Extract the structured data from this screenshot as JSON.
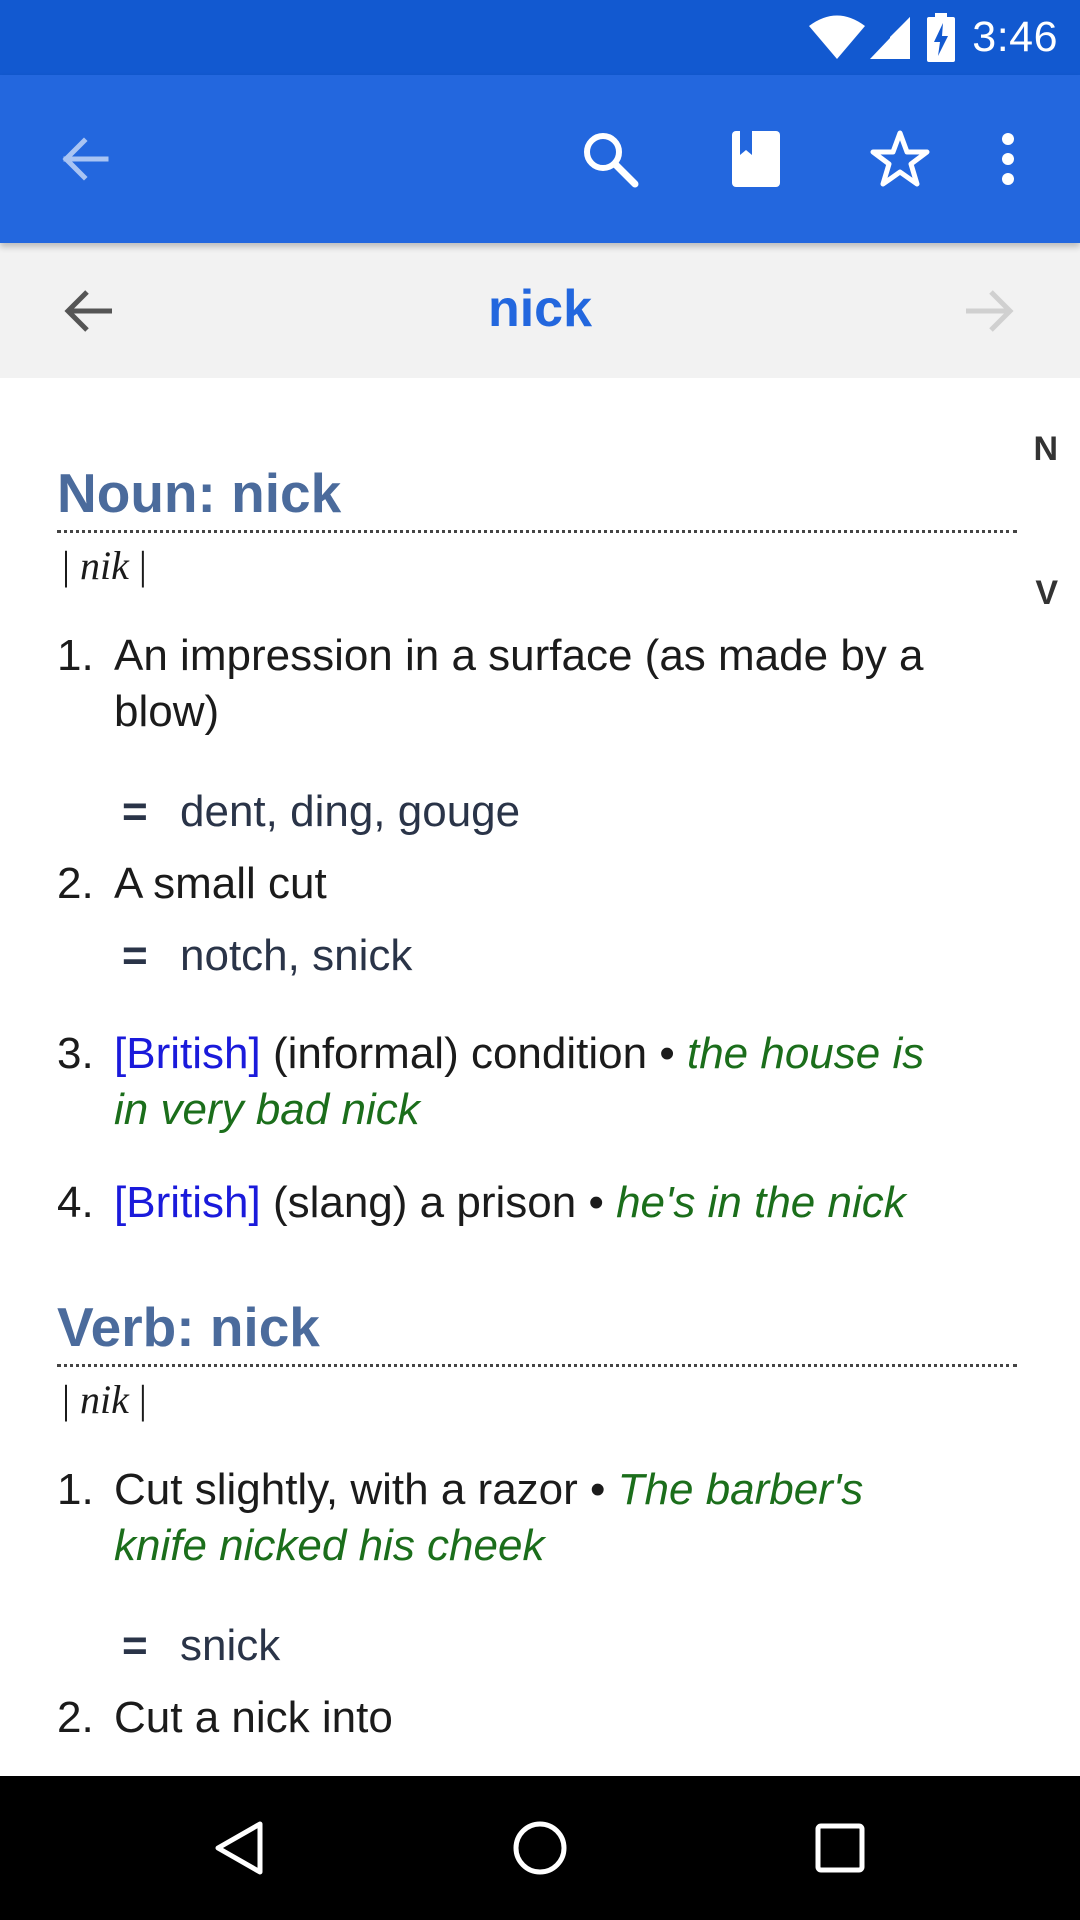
{
  "status_bar": {
    "time": "3:46",
    "icons": [
      "wifi-icon",
      "signal-icon",
      "battery-charging-icon"
    ]
  },
  "app_bar": {
    "icons": [
      "back-arrow-icon",
      "search-icon",
      "bookmark-icon",
      "star-outline-icon",
      "more-vert-icon"
    ],
    "color": "#2367de"
  },
  "word_nav": {
    "word": "nick",
    "prev_icon": "arrow-left-icon",
    "next_icon": "arrow-right-icon"
  },
  "side_index": [
    "N",
    "V"
  ],
  "noun": {
    "heading": "Noun: nick",
    "pron": "nik",
    "senses": [
      {
        "num": "1.",
        "text_line1": "An impression in a surface (as made by a",
        "text_line2": "blow)",
        "synonyms": [
          "dent",
          "ding",
          "gouge"
        ]
      },
      {
        "num": "2.",
        "text_line1": "A small cut",
        "synonyms": [
          "notch",
          "snick"
        ]
      },
      {
        "num": "3.",
        "region": "[British]",
        "text": "(informal) condition",
        "bullet": "•",
        "example_line1": "the house is",
        "example_line2": "in very bad nick"
      },
      {
        "num": "4.",
        "region": "[British]",
        "text": "(slang) a prison",
        "bullet": "•",
        "example": "he's in the nick"
      }
    ]
  },
  "verb": {
    "heading": "Verb: nick",
    "pron": "nik",
    "senses": [
      {
        "num": "1.",
        "text": "Cut slightly, with a razor",
        "bullet": "•",
        "example_line1": "The barber's",
        "example_line2": "knife nicked his cheek",
        "synonyms": [
          "snick"
        ]
      },
      {
        "num": "2.",
        "text": "Cut a nick into"
      }
    ]
  },
  "syn_marker": "=",
  "separator": ",",
  "pron_bar": "|",
  "colors": {
    "status_bar": "#1259d0",
    "heading": "#4b6b9c",
    "region": "#1a1adb",
    "example": "#1b6e1b",
    "word": "#2367de"
  },
  "system_nav": [
    "nav-back-icon",
    "nav-home-icon",
    "nav-recents-icon"
  ]
}
